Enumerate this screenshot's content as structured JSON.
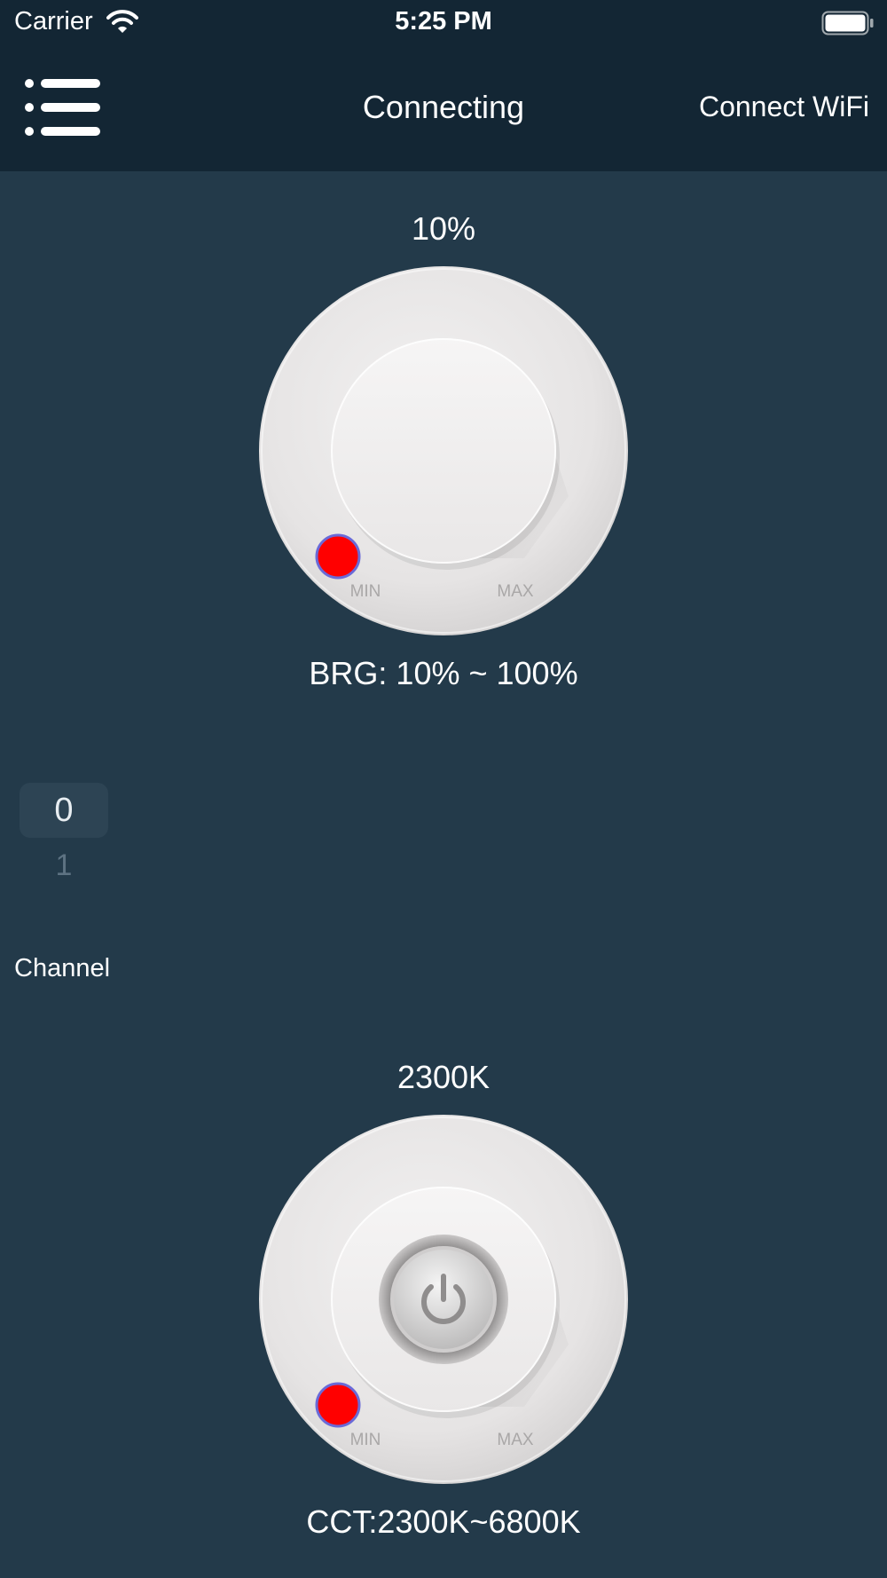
{
  "status_bar": {
    "carrier": "Carrier",
    "time": "5:25 PM",
    "wifi_icon": "wifi-icon",
    "battery_icon": "battery-full-icon"
  },
  "nav": {
    "menu_icon": "list-menu-icon",
    "title": "Connecting",
    "right_button": "Connect WiFi"
  },
  "brightness": {
    "value_text": "10%",
    "value_percent": 10,
    "min_label": "MIN",
    "max_label": "MAX",
    "range_text": "BRG: 10% ~ 100%"
  },
  "channel": {
    "options": [
      "0",
      "1"
    ],
    "selected": "0",
    "label": "Channel"
  },
  "cct": {
    "value_text": "2300K",
    "min_label": "MIN",
    "max_label": "MAX",
    "range_text": "CCT:2300K~6800K",
    "power_icon": "power-icon"
  },
  "colors": {
    "background": "#233a4a",
    "top_bar": "#132634",
    "indicator": "#ff0000",
    "knob_face": "#efeded"
  }
}
